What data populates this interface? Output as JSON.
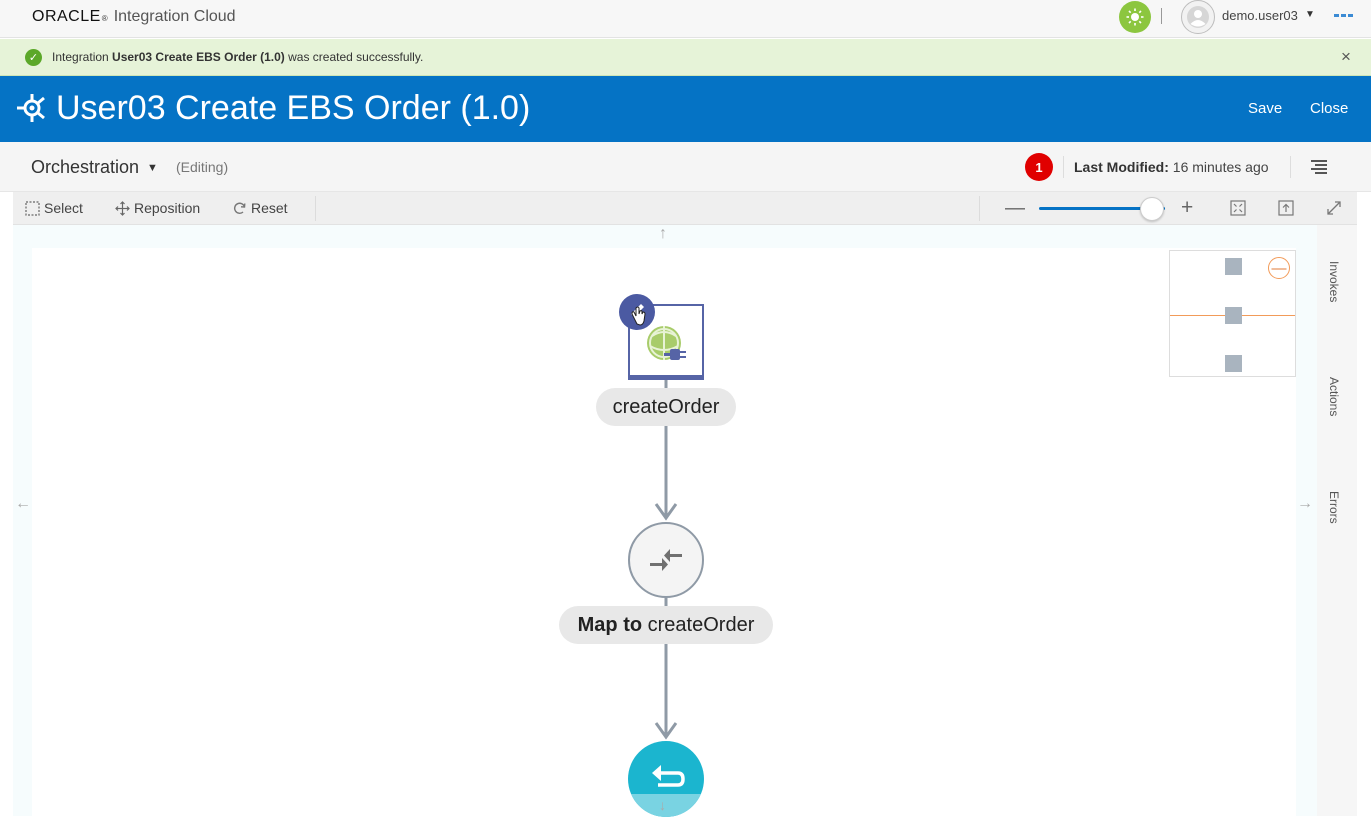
{
  "topbar": {
    "brand": "ORACLE",
    "product": "Integration Cloud",
    "user": "demo.user03"
  },
  "banner": {
    "prefix": "Integration ",
    "name": "User03 Create EBS Order (1.0)",
    "suffix": " was created successfully."
  },
  "header": {
    "title": "User03 Create EBS Order (1.0)",
    "save_label": "Save",
    "close_label": "Close"
  },
  "subheader": {
    "view": "Orchestration",
    "status": "(Editing)",
    "error_count": "1",
    "last_modified_label": "Last Modified:",
    "last_modified_value": "16 minutes ago"
  },
  "toolbar": {
    "select": "Select",
    "reposition": "Reposition",
    "reset": "Reset",
    "zoom_level": 0.9
  },
  "rail": {
    "tabs": [
      "Invokes",
      "Actions",
      "Errors"
    ]
  },
  "flow": {
    "nodes": [
      {
        "type": "invoke",
        "label": "createOrder"
      },
      {
        "type": "map",
        "label_bold": "Map to",
        "label_rest": "createOrder"
      },
      {
        "type": "return"
      }
    ]
  },
  "colors": {
    "header_blue": "#0573c5",
    "success_green": "#5ba829",
    "error_red": "#e00000",
    "invoke_purple": "#5664a6",
    "return_teal": "#1bb5cf"
  }
}
